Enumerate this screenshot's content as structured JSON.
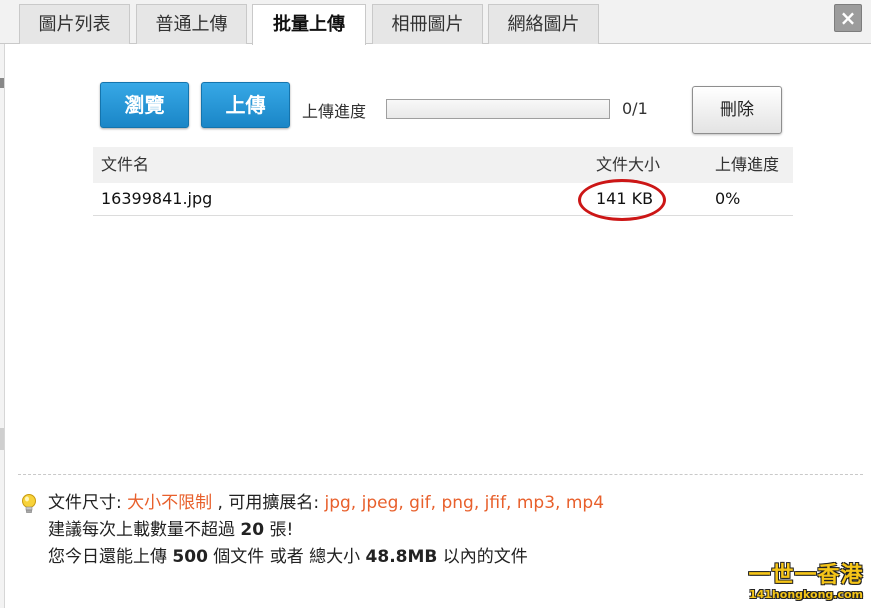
{
  "tabs": [
    {
      "label": "圖片列表",
      "active": false
    },
    {
      "label": "普通上傳",
      "active": false
    },
    {
      "label": "批量上傳",
      "active": true
    },
    {
      "label": "相冊圖片",
      "active": false
    },
    {
      "label": "網絡圖片",
      "active": false
    }
  ],
  "close": {
    "label": "×",
    "icon": "close-icon"
  },
  "toolbar": {
    "browse_label": "瀏覽",
    "upload_label": "上傳",
    "progress_label": "上傳進度",
    "progress_fraction": 0,
    "progress_count": "0/1",
    "delete_label": "刪除"
  },
  "table": {
    "headers": {
      "name": "文件名",
      "size": "文件大小",
      "progress": "上傳進度"
    },
    "rows": [
      {
        "name": "16399841.jpg",
        "size": "141 KB",
        "progress": "0%"
      }
    ]
  },
  "info": {
    "icon": "lightbulb-icon",
    "line1_prefix": "文件尺寸: ",
    "line1_size": "大小不限制",
    "line1_mid": " , 可用擴展名: ",
    "line1_exts": "jpg, jpeg, gif, png, jfif, mp3, mp4",
    "line2_prefix": "建議每次上載數量不超過 ",
    "line2_num": "20",
    "line2_suffix": " 張!",
    "line3_prefix": "您今日還能上傳 ",
    "line3_count": "500",
    "line3_mid": " 個文件 或者 總大小 ",
    "line3_size": "48.8MB",
    "line3_suffix": " 以內的文件"
  },
  "watermark": {
    "title": "一世一香港",
    "site": "141hongkong.com"
  },
  "colors": {
    "accent_blue": "#1a86c7",
    "highlight_orange": "#e8602c",
    "annotation_red": "#cc1616",
    "watermark_yellow": "#f5c518"
  }
}
